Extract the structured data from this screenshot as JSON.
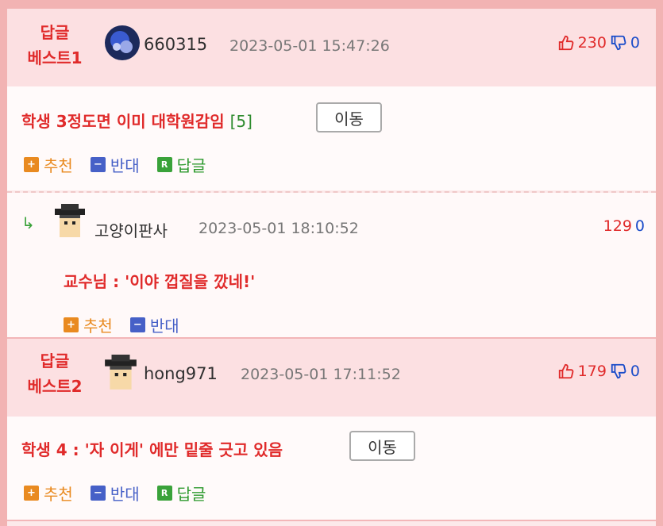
{
  "best1": {
    "label_line1": "답글",
    "label_line2": "베스트1",
    "nick": "660315",
    "date": "2023-05-01 15:47:26",
    "up": "230",
    "down": "0",
    "title": "학생 3정도면 이미 대학원감임",
    "count": "[5]",
    "move": "이동"
  },
  "reply1": {
    "nick": "고양이판사",
    "date": "2023-05-01 18:10:52",
    "up": "129",
    "down": "0",
    "text": "교수님 : '이야 껍질을 깠네!'"
  },
  "best2": {
    "label_line1": "답글",
    "label_line2": "베스트2",
    "nick": "hong971",
    "date": "2023-05-01 17:11:52",
    "up": "179",
    "down": "0",
    "title": "학생 4 : '자 이게' 에만 밑줄 긋고 있음",
    "move": "이동"
  },
  "actions": {
    "recommend": "추천",
    "oppose": "반대",
    "reply": "답글",
    "plus": "+",
    "minus": "−",
    "r": "R"
  },
  "colors": {
    "red": "#e02a2a",
    "blue": "#1a4cc9",
    "orange": "#e98a20",
    "green": "#3aa23a"
  }
}
